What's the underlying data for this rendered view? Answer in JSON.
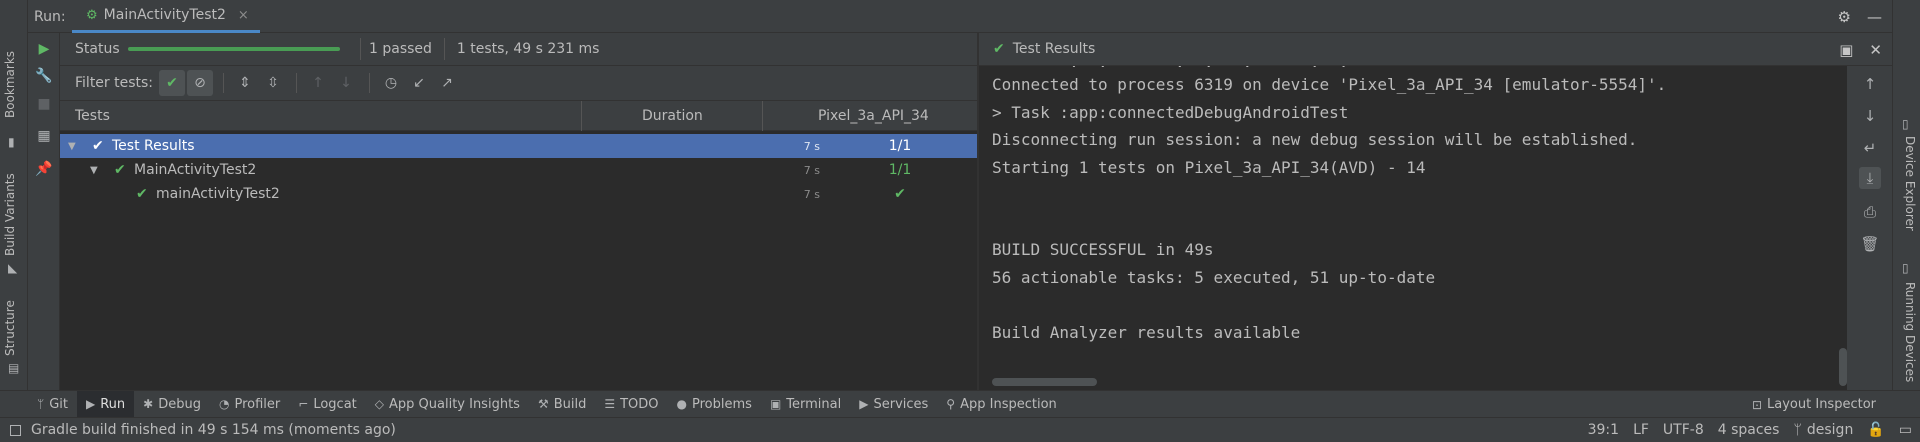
{
  "titlebar": {
    "run_label": "Run:",
    "tab_label": "MainActivityTest2",
    "tab_close": "×"
  },
  "left_strip": {
    "bookmarks": "Bookmarks",
    "build_variants": "Build Variants",
    "structure": "Structure"
  },
  "right_strip": {
    "device_explorer": "Device Explorer",
    "running_devices": "Running Devices"
  },
  "status": {
    "label": "Status",
    "progress": 1.0,
    "passed": "1 passed",
    "time": "1 tests, 49 s 231 ms"
  },
  "filter": {
    "label": "Filter tests:"
  },
  "table": {
    "col_tests": "Tests",
    "col_duration": "Duration",
    "col_device": "Pixel_3a_API_34",
    "rows": [
      {
        "name": "Test Results",
        "duration": "7 s",
        "device": "1/1"
      },
      {
        "name": "MainActivityTest2",
        "duration": "7 s",
        "device": "1/1"
      },
      {
        "name": "mainActivityTest2",
        "duration": "7 s",
        "device": "✔"
      }
    ]
  },
  "console": {
    "title": "Test Results",
    "lines": [
      "Connected to process 6319 on device 'Pixel_3a_API_34 [emulator-5554]'.",
      "> Task :app:connectedDebugAndroidTest",
      "Disconnecting run session: a new debug session will be established.",
      "Starting 1 tests on Pixel_3a_API_34(AVD) - 14",
      "",
      "",
      "BUILD SUCCESSFUL in 49s",
      "56 actionable tasks: 5 executed, 51 up-to-date",
      "",
      "Build Analyzer results available"
    ]
  },
  "bottom_tabs": [
    {
      "label": "Git",
      "icon": "branch-icon"
    },
    {
      "label": "Run",
      "icon": "play-icon"
    },
    {
      "label": "Debug",
      "icon": "bug-icon"
    },
    {
      "label": "Profiler",
      "icon": "gauge-icon"
    },
    {
      "label": "Logcat",
      "icon": "logcat-icon"
    },
    {
      "label": "App Quality Insights",
      "icon": "diamond-icon"
    },
    {
      "label": "Build",
      "icon": "hammer-icon"
    },
    {
      "label": "TODO",
      "icon": "list-icon"
    },
    {
      "label": "Problems",
      "icon": "info-icon"
    },
    {
      "label": "Terminal",
      "icon": "terminal-icon"
    },
    {
      "label": "Services",
      "icon": "services-icon"
    },
    {
      "label": "App Inspection",
      "icon": "inspection-icon"
    }
  ],
  "layout_inspector": "Layout Inspector",
  "statusbar": {
    "message": "Gradle build finished in 49 s 154 ms (moments ago)",
    "position": "39:1",
    "line_sep": "LF",
    "encoding": "UTF-8",
    "indent": "4 spaces",
    "branch": "design"
  },
  "colors": {
    "accent": "#4a88c7",
    "success": "#5fb865",
    "selection": "#4b6eaf"
  }
}
